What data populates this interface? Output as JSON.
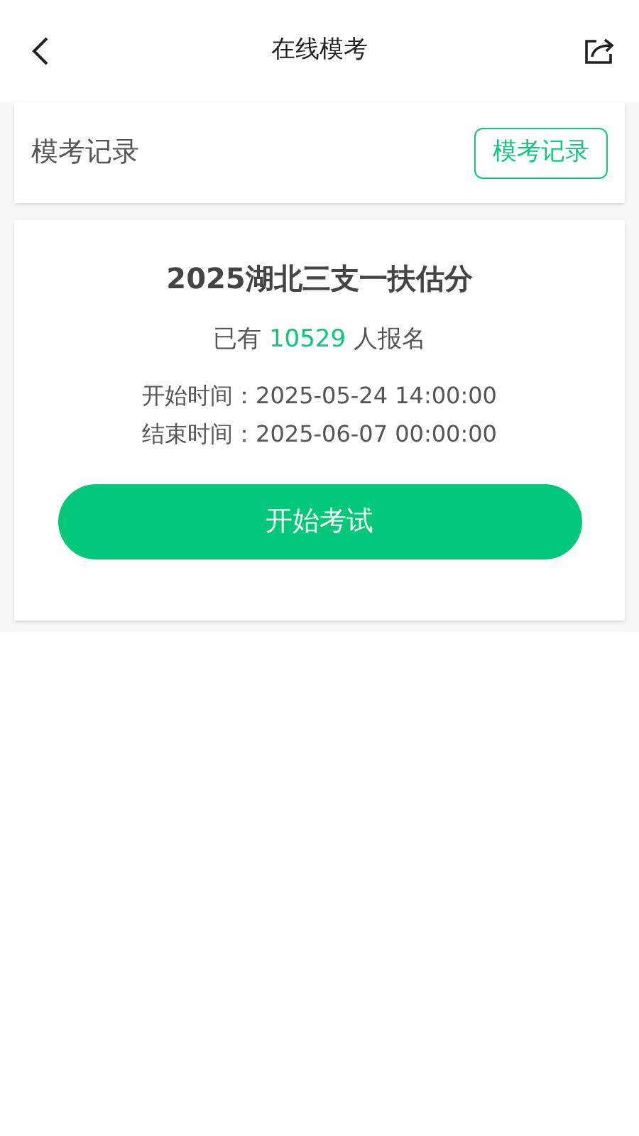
{
  "header": {
    "title": "在线模考"
  },
  "records_bar": {
    "label": "模考记录",
    "button": "模考记录"
  },
  "exam": {
    "title": "2025湖北三支一扶估分",
    "registration": {
      "prefix": "已有",
      "count": "10529",
      "suffix": "人报名"
    },
    "times": [
      "开始时间：2025-05-24 14:00:00",
      "结束时间：2025-06-07 00:00:00"
    ],
    "button": "开始考试"
  }
}
